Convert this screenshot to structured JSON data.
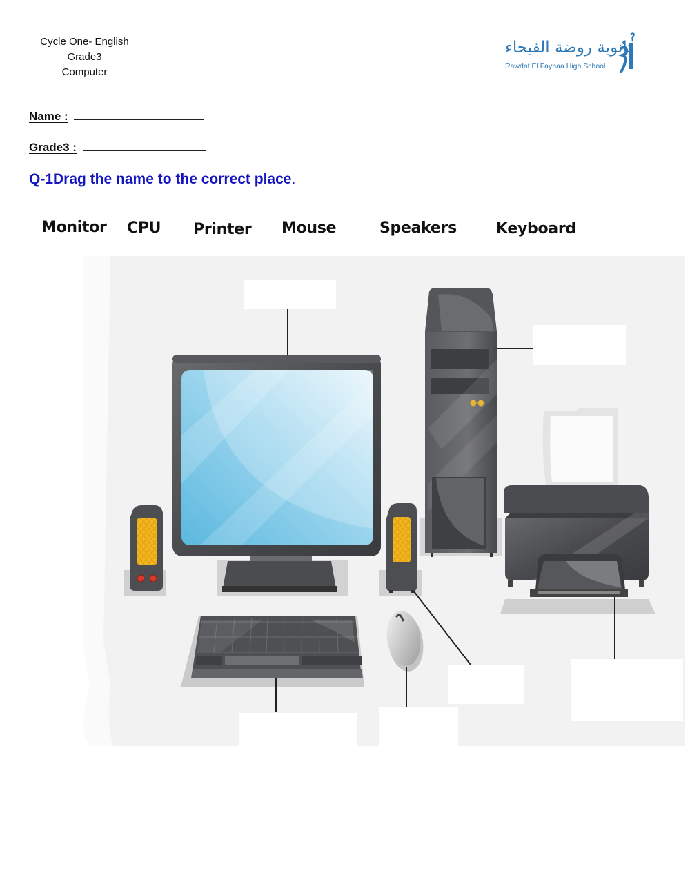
{
  "header": {
    "lines": [
      "Cycle One- English",
      "Grade3",
      "Computer"
    ],
    "school": {
      "name_arabic": "ثانوية روضة الفيحاء",
      "name_latin": "Rawdat El Fayhaa High School",
      "brand_color": "#2f79b8",
      "logo_icon": "school-logo-icon"
    }
  },
  "fields": {
    "name_label": "Name :",
    "grade_label": "Grade3 :",
    "name_value": "",
    "grade_value": ""
  },
  "question": {
    "text": "Q-1Drag the name to the correct place",
    "trailing": ".",
    "color": "#1515c0"
  },
  "word_bank": [
    {
      "label": "Monitor"
    },
    {
      "label": "CPU"
    },
    {
      "label": "Printer"
    },
    {
      "label": "Mouse"
    },
    {
      "label": "Speakers"
    },
    {
      "label": "Keyboard"
    }
  ],
  "illustration": {
    "objects": [
      "monitor",
      "cpu-tower",
      "printer",
      "speakers",
      "keyboard",
      "mouse"
    ],
    "drop_targets": [
      {
        "points_to": "monitor",
        "value": ""
      },
      {
        "points_to": "cpu",
        "value": ""
      },
      {
        "points_to": "speakers",
        "value": ""
      },
      {
        "points_to": "printer",
        "value": ""
      },
      {
        "points_to": "keyboard",
        "value": ""
      },
      {
        "points_to": "mouse",
        "value": ""
      }
    ],
    "colors": {
      "panel_bg": "#f2f2f2",
      "device_dark": "#4a4b4e",
      "screen_blue": "#6fc3e4",
      "speaker_grille": "#f2b51d",
      "speaker_button": "#d63a2a"
    }
  }
}
